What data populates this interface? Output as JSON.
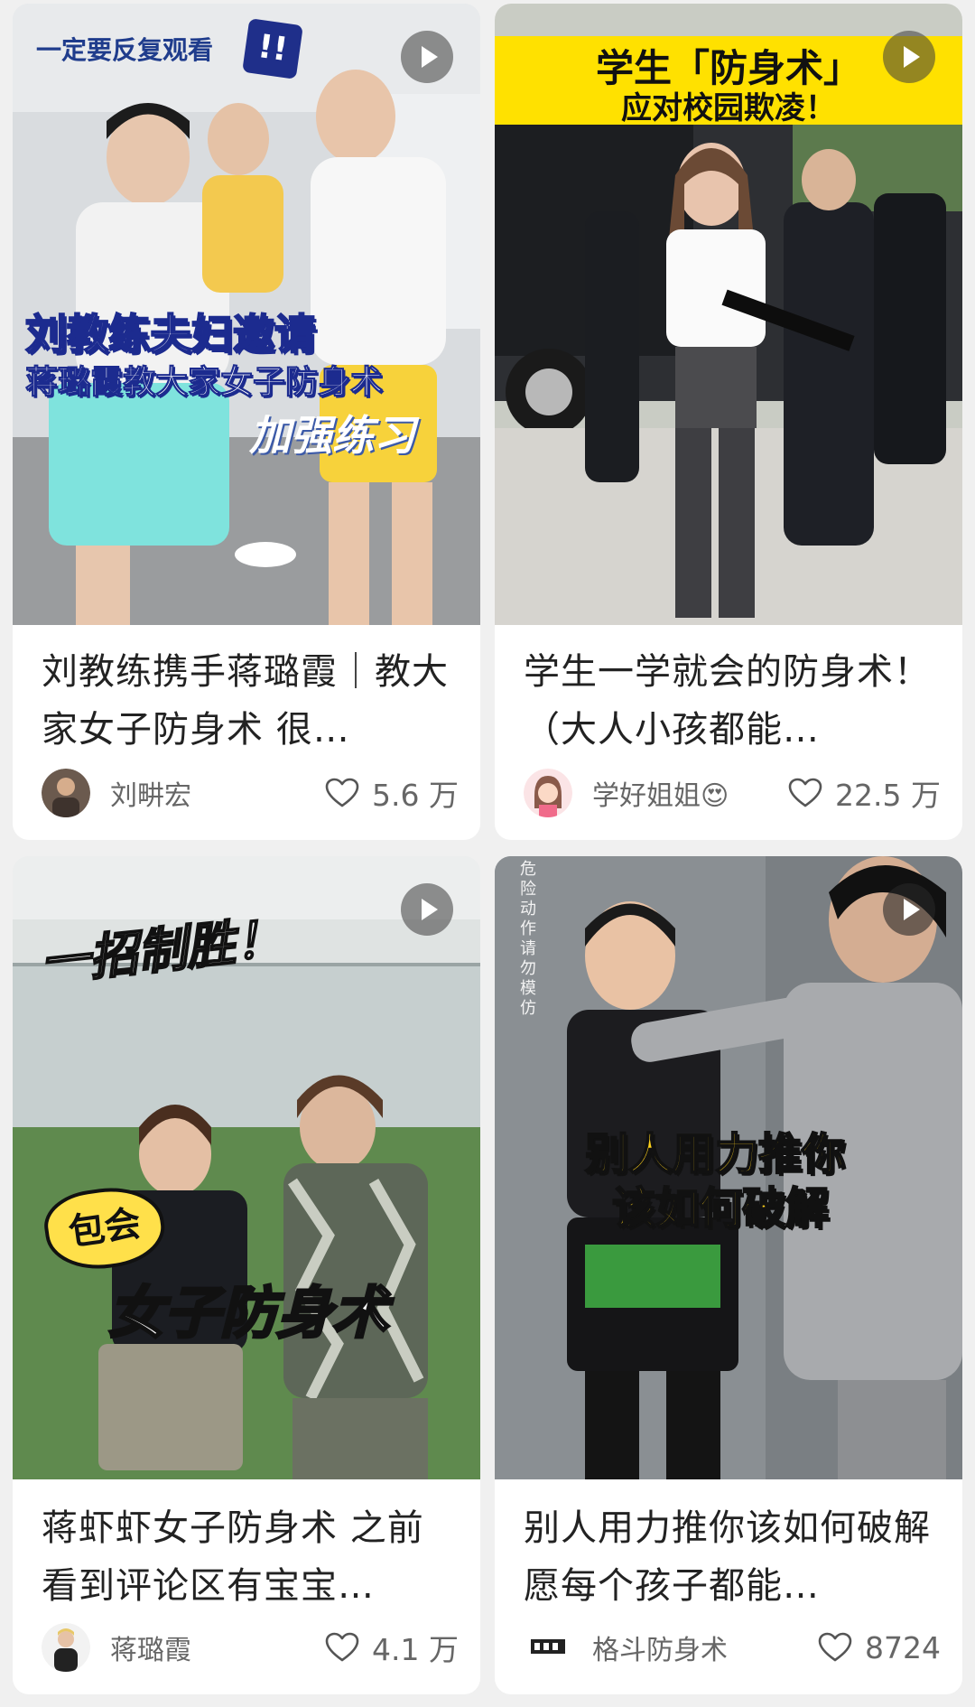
{
  "cards": [
    {
      "title": "刘教练携手蒋璐霞｜教大家女子防身术 很…",
      "author": "刘畊宏",
      "likes": "5.6 万",
      "overlay": {
        "top_banner": "一定要反复观看",
        "exclaim": "!!",
        "line1": "刘教练夫妇邀请",
        "line2": "蒋璐霞教大家女子防身术",
        "line3": "加强练习"
      }
    },
    {
      "title": "学生一学就会的防身术！（大人小孩都能…",
      "author": "学好姐姐😍",
      "likes": "22.5 万",
      "overlay": {
        "line1": "学生「防身术」",
        "line2": "应对校园欺凌！"
      }
    },
    {
      "title": "蒋虾虾女子防身术 之前看到评论区有宝宝…",
      "author": "蒋璐霞",
      "likes": "4.1 万",
      "overlay": {
        "line1": "一招制胜！",
        "badge": "包会",
        "line2": "女子防身术"
      }
    },
    {
      "title": "别人用力推你该如何破解 愿每个孩子都能…",
      "author": "格斗防身术",
      "likes": "8724",
      "overlay": {
        "warning": "危险动作 请勿模仿",
        "line1": "别人用力推你",
        "line2": "该如何破解"
      }
    }
  ],
  "icons": {
    "play": "play-icon",
    "like": "heart-outline-icon"
  },
  "colors": {
    "background": "#f0f0f0",
    "card": "#ffffff",
    "title": "#222222",
    "meta": "#666666",
    "banner_yellow": "#ffe100"
  }
}
